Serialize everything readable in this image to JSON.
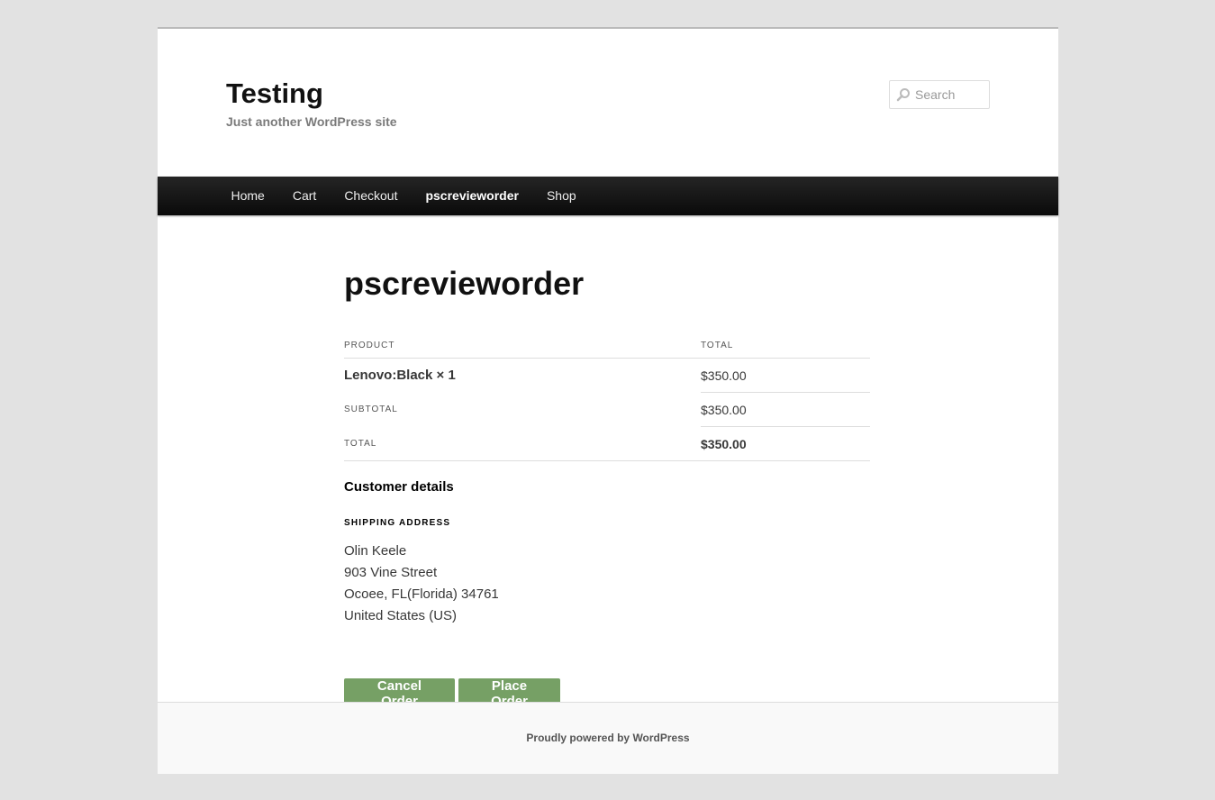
{
  "site": {
    "title": "Testing",
    "description": "Just another WordPress site"
  },
  "search": {
    "placeholder": "Search",
    "icon": "search-icon"
  },
  "nav": {
    "items": [
      {
        "label": "Home"
      },
      {
        "label": "Cart"
      },
      {
        "label": "Checkout"
      },
      {
        "label": "pscrevieworder",
        "current": true
      },
      {
        "label": "Shop"
      }
    ]
  },
  "page": {
    "title": "pscrevieworder"
  },
  "order_table": {
    "headers": {
      "product": "PRODUCT",
      "total": "TOTAL"
    },
    "items": [
      {
        "product": "Lenovo:Black × 1",
        "total": "$350.00"
      }
    ],
    "subtotal_label": "SUBTOTAL",
    "subtotal_value": "$350.00",
    "total_label": "TOTAL",
    "total_value": "$350.00"
  },
  "customer": {
    "title": "Customer details",
    "shipping_title": "SHIPPING ADDRESS",
    "address": {
      "line1": "Olin Keele",
      "line2": "903 Vine Street",
      "line3": "Ocoee, FL(Florida) 34761",
      "line4": "United States (US)"
    }
  },
  "actions": {
    "cancel_label": "Cancel Order",
    "place_label": "Place Order"
  },
  "footer": {
    "credit": "Proudly powered by WordPress"
  },
  "colors": {
    "button": "#76a065",
    "nav_bg": "#0a0a0a",
    "page_bg": "#e2e2e2"
  }
}
